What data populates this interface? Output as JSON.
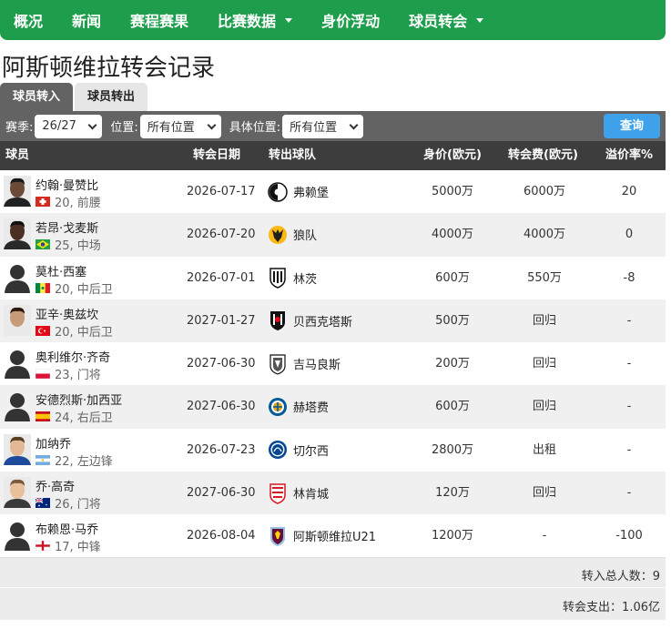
{
  "nav": {
    "items": [
      "概况",
      "新闻",
      "赛程赛果",
      "比赛数据",
      "身价浮动",
      "球员转会"
    ]
  },
  "page_title": "阿斯顿维拉转会记录",
  "tabs": [
    "球员转入",
    "球员转出"
  ],
  "filters": {
    "season_label": "赛季:",
    "season_value": "26/27",
    "position_label": "位置:",
    "position_value": "所有位置",
    "detail_label": "具体位置:",
    "detail_value": "所有位置",
    "query_button": "查询"
  },
  "table": {
    "headers": [
      "球员",
      "转会日期",
      "转出球队",
      "身价(欧元)",
      "转会费(欧元)",
      "溢价率%"
    ],
    "rows": [
      {
        "name": "约翰·曼赞比",
        "meta": "20, 前腰",
        "flag": "switzerland",
        "date": "2026-07-17",
        "club": "弗赖堡",
        "club_icon": "freiburg-badge",
        "value": "5000万",
        "fee": "6000万",
        "premium": "20",
        "avatar": "photo"
      },
      {
        "name": "若昂·戈麦斯",
        "meta": "25, 中场",
        "flag": "brazil",
        "date": "2026-07-20",
        "club": "狼队",
        "club_icon": "wolves-badge",
        "value": "4000万",
        "fee": "4000万",
        "premium": "0",
        "avatar": "photo"
      },
      {
        "name": "莫杜·西塞",
        "meta": "20, 中后卫",
        "flag": "senegal",
        "date": "2026-07-01",
        "club": "林茨",
        "club_icon": "lask-badge",
        "value": "600万",
        "fee": "550万",
        "premium": "-8",
        "avatar": "silhouette"
      },
      {
        "name": "亚辛·奥兹坎",
        "meta": "20, 中后卫",
        "flag": "turkey",
        "date": "2027-01-27",
        "club": "贝西克塔斯",
        "club_icon": "besiktas-badge",
        "value": "500万",
        "fee": "回归",
        "premium": "-",
        "avatar": "photo"
      },
      {
        "name": "奥利维尔·齐奇",
        "meta": "23, 门将",
        "flag": "poland",
        "date": "2027-06-30",
        "club": "吉马良斯",
        "club_icon": "guimaraes-badge",
        "value": "200万",
        "fee": "回归",
        "premium": "-",
        "avatar": "silhouette"
      },
      {
        "name": "安德烈斯·加西亚",
        "meta": "24, 右后卫",
        "flag": "spain",
        "date": "2027-06-30",
        "club": "赫塔费",
        "club_icon": "getafe-badge",
        "value": "600万",
        "fee": "回归",
        "premium": "-",
        "avatar": "silhouette"
      },
      {
        "name": "加纳乔",
        "meta": "22, 左边锋",
        "flag": "argentina",
        "date": "2026-07-23",
        "club": "切尔西",
        "club_icon": "chelsea-badge",
        "value": "2800万",
        "fee": "出租",
        "premium": "-",
        "avatar": "photo"
      },
      {
        "name": "乔·高奇",
        "meta": "26, 门将",
        "flag": "australia",
        "date": "2027-06-30",
        "club": "林肯城",
        "club_icon": "lincoln-badge",
        "value": "120万",
        "fee": "回归",
        "premium": "-",
        "avatar": "photo"
      },
      {
        "name": "布赖恩·马乔",
        "meta": "17, 中锋",
        "flag": "england",
        "date": "2026-08-04",
        "club": "阿斯顿维拉U21",
        "club_icon": "aston-villa-badge",
        "value": "1200万",
        "fee": "-",
        "premium": "-100",
        "avatar": "silhouette"
      }
    ]
  },
  "summary": {
    "total_in": "转入总人数：9",
    "total_spend": "转会支出：1.06亿"
  }
}
